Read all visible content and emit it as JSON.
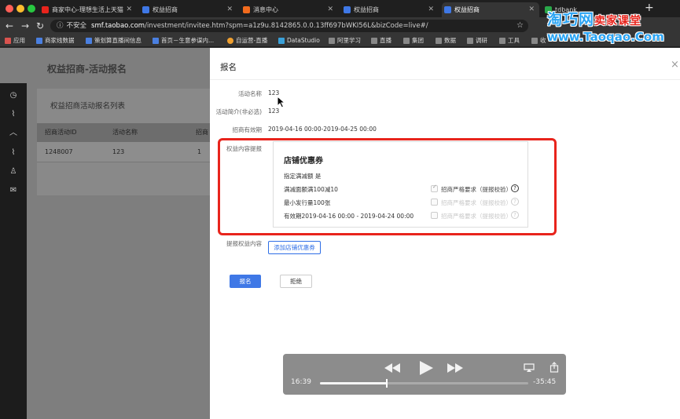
{
  "browser": {
    "tabs": [
      {
        "label": "商家中心-理想生活上天猫",
        "favicon_color": "#e8241c"
      },
      {
        "label": "权益招商",
        "favicon_color": "#3f78e6"
      },
      {
        "label": "消息中心",
        "favicon_color": "#f26b1d"
      },
      {
        "label": "权益招商",
        "favicon_color": "#3f78e6"
      },
      {
        "label": "权益招商",
        "favicon_color": "#3f78e6",
        "active": true
      },
      {
        "label": "tdbank",
        "favicon_color": "#2aa84a"
      }
    ],
    "new_tab_symbol": "+",
    "address": {
      "security_label": "不安全",
      "host": "smf.taobao.com",
      "path": "/investment/invitee.htm?spm=a1z9u.8142865.0.0.13ff697bWKI56L&bizCode=live#/"
    },
    "bookmarks": [
      {
        "label": "应用",
        "color": "#d9534f"
      },
      {
        "label": "商家线数据",
        "color": "#4a7fe0"
      },
      {
        "label": "策划算直播间信息",
        "color": "#4a7fe0"
      },
      {
        "label": "首页－生意参谋内...",
        "color": "#4a7fe0"
      },
      {
        "label": "自运营-直播",
        "color": "#f0a030"
      },
      {
        "label": "DataStudio",
        "color": "#3aa0d8"
      },
      {
        "label": "阿里学习",
        "color": "#888888"
      },
      {
        "label": "直播",
        "color": "#888888"
      },
      {
        "label": "集团",
        "color": "#888888"
      },
      {
        "label": "数据",
        "color": "#888888"
      },
      {
        "label": "调研",
        "color": "#888888"
      },
      {
        "label": "工具",
        "color": "#888888"
      },
      {
        "label": "收",
        "color": "#888888"
      }
    ]
  },
  "page": {
    "title": "权益招商-活动报名",
    "list": {
      "title": "权益招商活动报名列表",
      "columns": [
        "招商活动ID",
        "活动名称",
        "招商"
      ],
      "rows": [
        [
          "1248007",
          "123",
          "1"
        ]
      ]
    }
  },
  "drawer": {
    "title": "报名",
    "close_symbol": "×",
    "fields": {
      "activity_name_label": "活动名称",
      "activity_name_value": "123",
      "intro_label": "活动简介(非必选)",
      "intro_value": "123",
      "period_label": "招商有效期",
      "period_value": "2019-04-16 00:00-2019-04-25 00:00",
      "content_label": "权益内容提报",
      "benefit_label": "提报权益内容"
    },
    "coupon": {
      "title": "店铺优惠券",
      "lines": [
        "指定满减额  是",
        "满减面额满100减10",
        "最小发行量100张",
        "有效期2019-04-16 00:00 - 2019-04-24 00:00"
      ],
      "checks": [
        {
          "label": "招商严格要求（提报校验）",
          "enabled": true
        },
        {
          "label": "招商严格要求（提报校验）",
          "enabled": false
        },
        {
          "label": "招商严格要求（提报校验）",
          "enabled": false
        }
      ],
      "help_symbol": "?"
    },
    "add_coupon_button": "添加店铺优惠券",
    "submit_button": "报名",
    "reject_button": "拒绝"
  },
  "player": {
    "elapsed": "16:39",
    "remaining": "-35:45",
    "progress_fraction": 0.32
  },
  "watermark": {
    "line1": "淘巧网",
    "line1_tail": "卖家课堂",
    "line2": "www.Taoqao.Com"
  }
}
